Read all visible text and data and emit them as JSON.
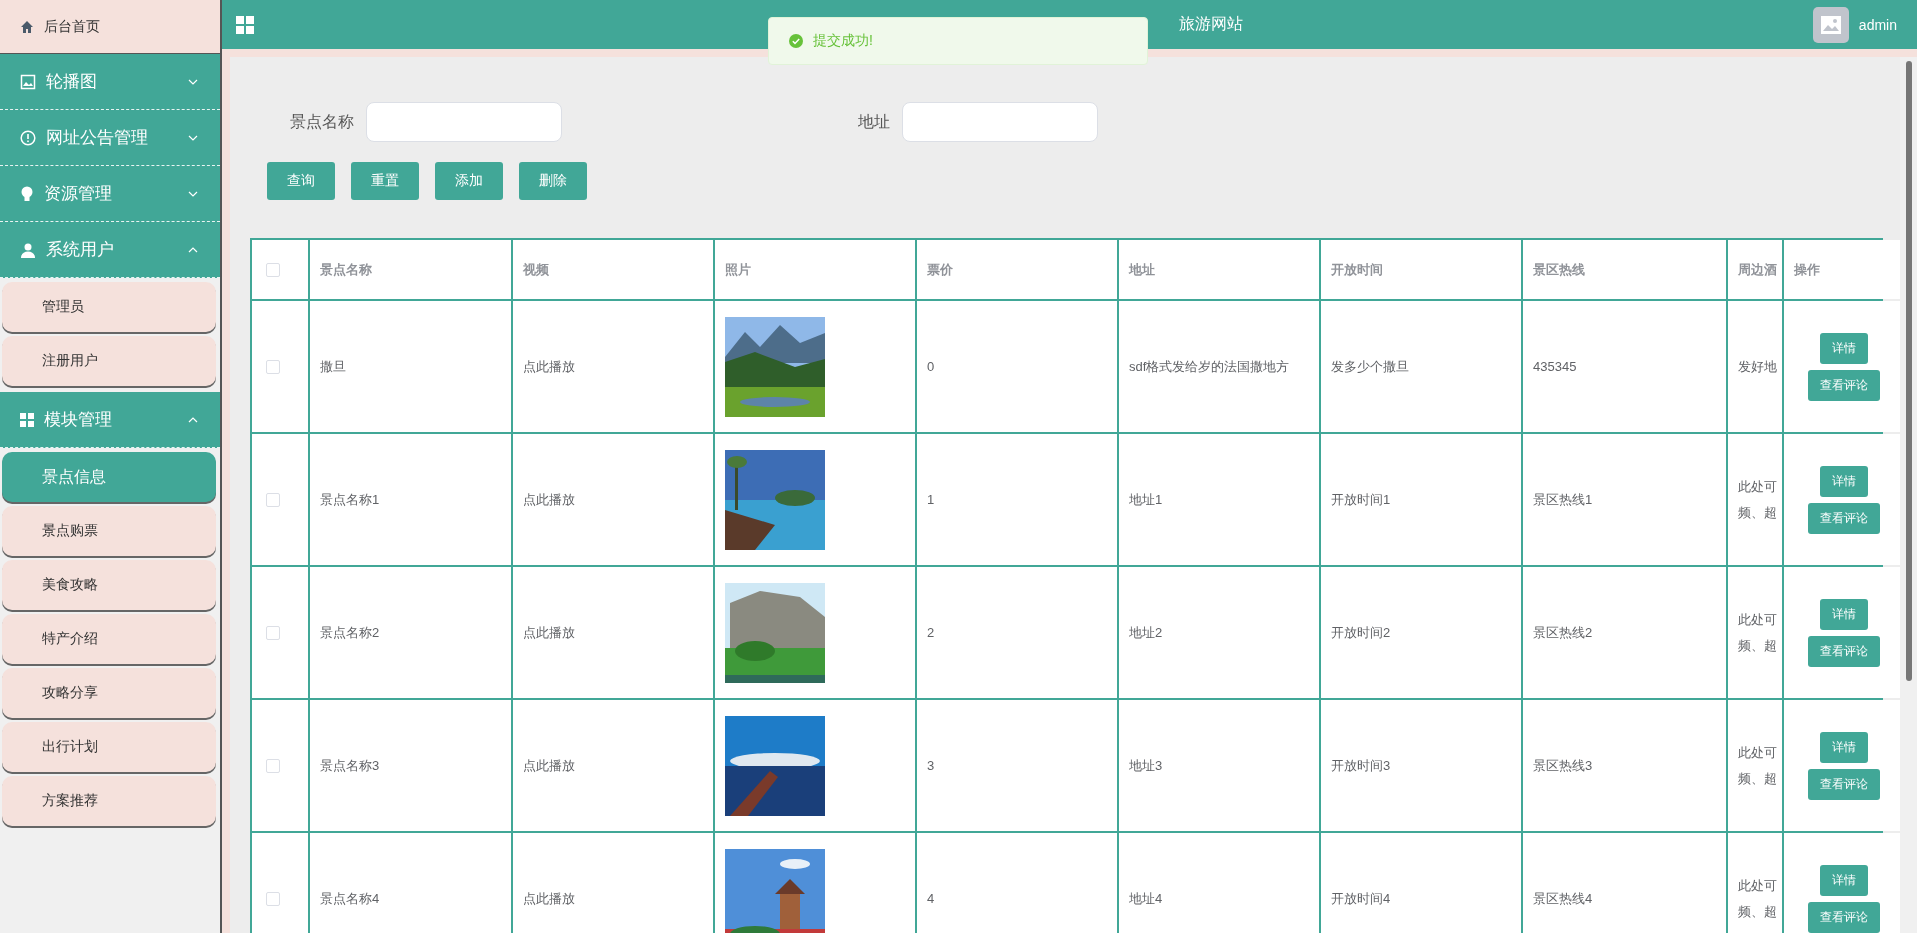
{
  "sidebar": {
    "home": "后台首页",
    "groups": [
      {
        "label": "轮播图",
        "expanded": false
      },
      {
        "label": "网址公告管理",
        "expanded": false
      },
      {
        "label": "资源管理",
        "expanded": false
      },
      {
        "label": "系统用户",
        "expanded": true,
        "items": [
          {
            "label": "管理员",
            "selected": false
          },
          {
            "label": "注册用户",
            "selected": false
          }
        ]
      },
      {
        "label": "模块管理",
        "expanded": true,
        "items": [
          {
            "label": "景点信息",
            "selected": true
          },
          {
            "label": "景点购票",
            "selected": false
          },
          {
            "label": "美食攻略",
            "selected": false
          },
          {
            "label": "特产介绍",
            "selected": false
          },
          {
            "label": "攻略分享",
            "selected": false
          },
          {
            "label": "出行计划",
            "selected": false
          },
          {
            "label": "方案推荐",
            "selected": false
          }
        ]
      }
    ]
  },
  "header": {
    "title": "旅游网站",
    "user": "admin"
  },
  "toast": {
    "message": "提交成功!"
  },
  "search": {
    "fields": [
      {
        "label": "景点名称"
      },
      {
        "label": "地址"
      }
    ],
    "buttons": [
      "查询",
      "重置",
      "添加",
      "删除"
    ]
  },
  "table": {
    "columns": [
      "景点名称",
      "视频",
      "照片",
      "票价",
      "地址",
      "开放时间",
      "景区热线",
      "周边酒",
      "操作"
    ],
    "header_checkbox": {
      "checked": false
    },
    "rows": [
      {
        "checked": false,
        "name": "撒旦",
        "video": "点此播放",
        "photo": {
          "kind": "picture"
        },
        "price": "0",
        "address": "sdf格式发给岁的法国撒地方",
        "open_time": "发多少个撒旦",
        "hotline": "435345",
        "nearby": [
          "发好地"
        ],
        "actions": [
          "详情",
          "查看评论"
        ]
      },
      {
        "checked": false,
        "name": "景点名称1",
        "video": "点此播放",
        "photo": {
          "kind": "picture"
        },
        "price": "1",
        "address": "地址1",
        "open_time": "开放时间1",
        "hotline": "景区热线1",
        "nearby": [
          "此处可",
          "频、超"
        ],
        "actions": [
          "详情",
          "查看评论"
        ]
      },
      {
        "checked": false,
        "name": "景点名称2",
        "video": "点此播放",
        "photo": {
          "kind": "picture"
        },
        "price": "2",
        "address": "地址2",
        "open_time": "开放时间2",
        "hotline": "景区热线2",
        "nearby": [
          "此处可",
          "频、超"
        ],
        "actions": [
          "详情",
          "查看评论"
        ]
      },
      {
        "checked": false,
        "name": "景点名称3",
        "video": "点此播放",
        "photo": {
          "kind": "picture"
        },
        "price": "3",
        "address": "地址3",
        "open_time": "开放时间3",
        "hotline": "景区热线3",
        "nearby": [
          "此处可",
          "频、超"
        ],
        "actions": [
          "详情",
          "查看评论"
        ]
      },
      {
        "checked": false,
        "name": "景点名称4",
        "video": "点此播放",
        "photo": {
          "kind": "picture"
        },
        "price": "4",
        "address": "地址4",
        "open_time": "开放时间4",
        "hotline": "景区热线4",
        "nearby": [
          "此处可",
          "频、超"
        ],
        "actions": [
          "详情",
          "查看评论"
        ]
      }
    ]
  }
}
